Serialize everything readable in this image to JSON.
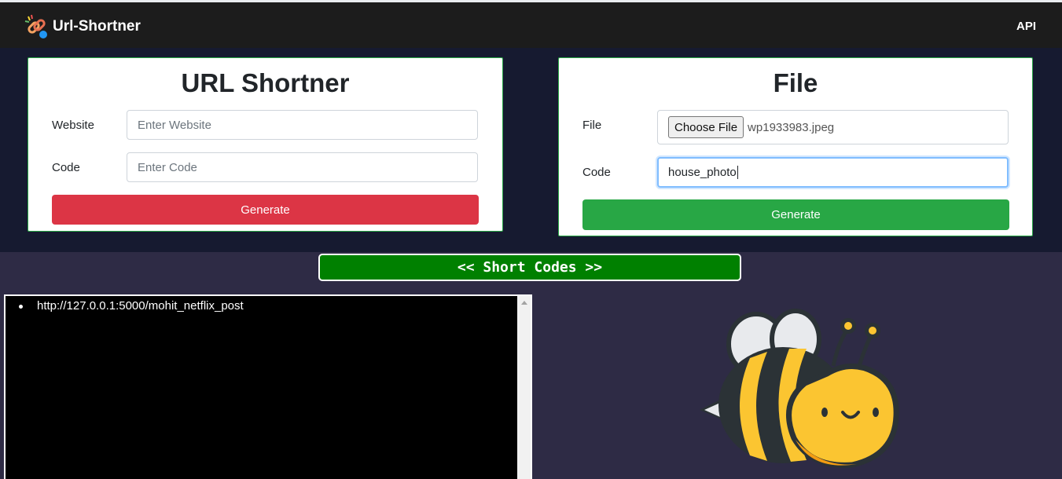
{
  "navbar": {
    "brand": "Url-Shortner",
    "logo_icon": "chain-link-icon",
    "api_link": "API"
  },
  "url_form": {
    "title": "URL Shortner",
    "website_label": "Website",
    "website_placeholder": "Enter Website",
    "code_label": "Code",
    "code_placeholder": "Enter Code",
    "generate_label": "Generate"
  },
  "file_form": {
    "title": "File",
    "file_label": "File",
    "choose_button": "Choose File",
    "file_name": "wp1933983.jpeg",
    "code_label": "Code",
    "code_value": "house_photo",
    "generate_label": "Generate"
  },
  "short_codes": {
    "heading": "<< Short Codes >>",
    "items": [
      "http://127.0.0.1:5000/mohit_netflix_post"
    ]
  },
  "colors": {
    "navbar": "#1c1c1c",
    "forms_band": "#161a30",
    "page_bg": "#2e2b45",
    "danger": "#dc3545",
    "success": "#28a745",
    "short_codes_bg": "#008000"
  },
  "illustration": "bee-illustration"
}
